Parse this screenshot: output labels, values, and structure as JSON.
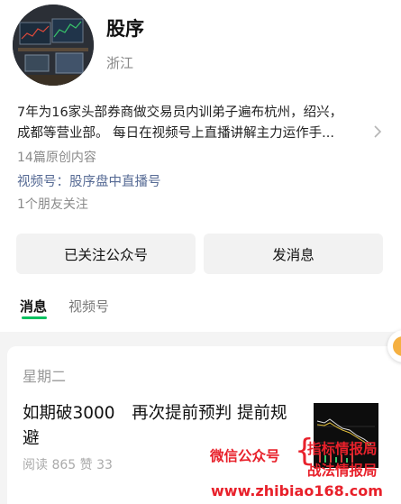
{
  "profile": {
    "name": "股序",
    "region": "浙江",
    "bio_line1": "7年为16家头部券商做交易员内训弟子遍布杭州，绍兴，",
    "bio_line2": "成都等营业部。 每日在视频号上直播讲解主力运作手...",
    "bio_chevron": "chevron-right-icon",
    "article_count": "14篇原创内容",
    "channel_label": "视频号：股序盘中直播号",
    "friends_following": "1个朋友关注"
  },
  "actions": {
    "followed_label": "已关注公众号",
    "message_label": "发消息"
  },
  "tabs": [
    {
      "label": "消息",
      "active": true
    },
    {
      "label": "视频号",
      "active": false
    }
  ],
  "feed": {
    "weekday": "星期二",
    "article": {
      "title": "如期破3000　再次提前预判 提前规避",
      "stats": "阅读 865  赞 33"
    }
  },
  "watermark": {
    "left_text": "微信公众号",
    "brace": "{",
    "right_line1": "指标情报局",
    "right_line2": "战法情报局",
    "url": "www.zhibiao168.com"
  },
  "colors": {
    "accent_green": "#07c160",
    "link_blue": "#576b95",
    "watermark_red": "#e8212b"
  }
}
